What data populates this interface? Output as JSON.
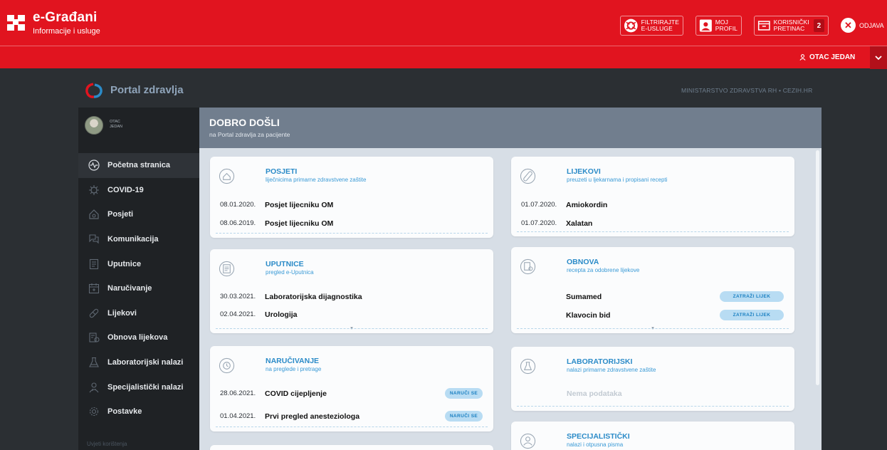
{
  "header": {
    "brand_title": "e-Građani",
    "brand_subtitle": "Informacije i usluge",
    "buttons": [
      {
        "line1": "FILTRIRAJTE",
        "line2": "E-USLUGE",
        "icon": "filter-services-icon"
      },
      {
        "line1": "MOJ",
        "line2": "PROFIL",
        "icon": "profile-icon"
      },
      {
        "line1": "KORISNIČKI",
        "line2": "PRETINAC",
        "icon": "inbox-icon",
        "count": "2"
      }
    ],
    "logout": "ODJAVA",
    "user": "OTAC JEDAN"
  },
  "portal": {
    "title": "Portal zdravlja",
    "ministry": "MINISTARSTVO ZDRAVSTVA RH • CEZIH.HR"
  },
  "sidebar": {
    "profile_name_line1": "OTAC",
    "profile_name_line2": "JEDAN",
    "items": [
      {
        "label": "Početna stranica",
        "icon": "pulse-icon",
        "active": true
      },
      {
        "label": "COVID-19",
        "icon": "virus-icon"
      },
      {
        "label": "Posjeti",
        "icon": "house-icon"
      },
      {
        "label": "Komunikacija",
        "icon": "chat-icon"
      },
      {
        "label": "Uputnice",
        "icon": "document-icon"
      },
      {
        "label": "Naručivanje",
        "icon": "calendar-icon"
      },
      {
        "label": "Lijekovi",
        "icon": "pill-icon"
      },
      {
        "label": "Obnova lijekova",
        "icon": "refill-icon"
      },
      {
        "label": "Laboratorijski nalazi",
        "icon": "flask-icon"
      },
      {
        "label": "Specijalistički nalazi",
        "icon": "doctor-icon"
      },
      {
        "label": "Postavke",
        "icon": "gear-icon"
      }
    ],
    "footer_link": "Uvjeti korištenja"
  },
  "welcome": {
    "title": "DOBRO DOŠLI",
    "subtitle": "na Portal zdravlja za pacijente"
  },
  "cards": {
    "posjeti": {
      "title": "POSJETI",
      "subtitle": "liječnicima primarne zdravstvene zaštite",
      "rows": [
        {
          "date": "08.01.2020.",
          "name": "Posjet lijecniku OM"
        },
        {
          "date": "08.06.2019.",
          "name": "Posjet lijecniku OM"
        }
      ]
    },
    "lijekovi": {
      "title": "LIJEKOVI",
      "subtitle": "preuzeti u ljekarnama i propisani recepti",
      "rows": [
        {
          "date": "01.07.2020.",
          "name": "Amiokordin"
        },
        {
          "date": "01.07.2020.",
          "name": "Xalatan"
        }
      ]
    },
    "uputnice": {
      "title": "UPUTNICE",
      "subtitle": "pregled e-Uputnica",
      "rows": [
        {
          "date": "30.03.2021.",
          "name": "Laboratorijska dijagnostika"
        },
        {
          "date": "02.04.2021.",
          "name": "Urologija"
        }
      ]
    },
    "obnova": {
      "title": "OBNOVA",
      "subtitle": "recepta za odobrene lijekove",
      "action_label": "ZATRAŽI LIJEK",
      "rows": [
        {
          "name": "Sumamed"
        },
        {
          "name": "Klavocin bid"
        }
      ]
    },
    "narucivanje": {
      "title": "NARUČIVANJE",
      "subtitle": "na preglede i pretrage",
      "action_label": "NARUČI SE",
      "rows": [
        {
          "date": "28.06.2021.",
          "name": "COVID cijepljenje"
        },
        {
          "date": "01.04.2021.",
          "name": "Prvi pregled anesteziologa"
        }
      ]
    },
    "laboratorijski": {
      "title": "LABORATORIJSKI",
      "subtitle": "nalazi primarne zdravstvene zaštite",
      "empty": "Nema podataka"
    },
    "specijalisticki": {
      "title": "SPECIJALISTIČKI",
      "subtitle": "nalazi i otpusna pisma"
    }
  },
  "colors": {
    "brand_red": "#e1141f",
    "link_blue": "#2b8bc8",
    "sidebar_bg": "#1f2225",
    "welcome_bg": "#717e8e"
  }
}
